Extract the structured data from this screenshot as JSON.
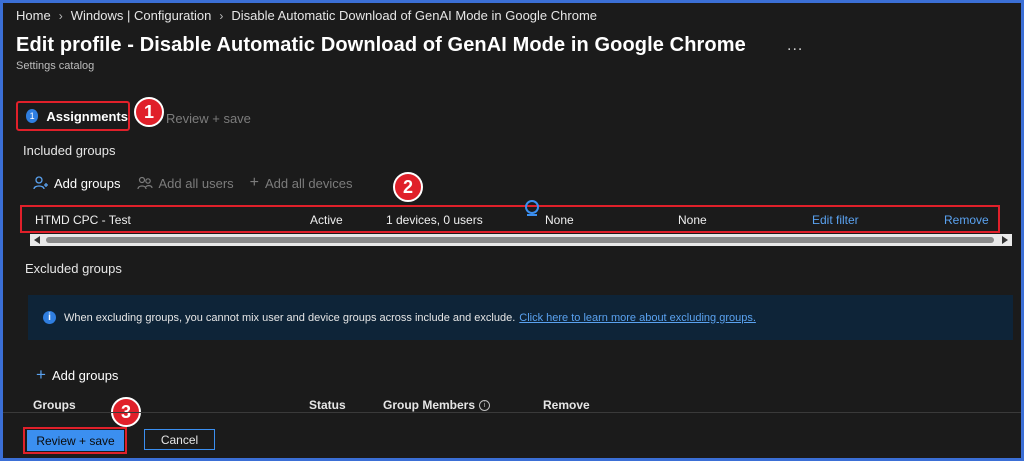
{
  "breadcrumb": {
    "items": [
      "Home",
      "Windows | Configuration",
      "Disable Automatic Download of GenAI Mode in Google Chrome"
    ],
    "separator": ">"
  },
  "page": {
    "title": "Edit profile - Disable Automatic Download of GenAI Mode in Google Chrome",
    "more_label": "...",
    "subtitle": "Settings catalog"
  },
  "steps": {
    "active": {
      "number": "1",
      "label": "Assignments"
    },
    "next": {
      "label": "Review + save"
    }
  },
  "callouts": [
    "1",
    "2",
    "3"
  ],
  "included": {
    "label": "Included groups",
    "toolbar": {
      "add_groups": "Add groups",
      "add_all_users": "Add all users",
      "add_all_devices": "Add all devices"
    },
    "row": {
      "group": "HTMD CPC - Test",
      "status": "Active",
      "members": "1 devices, 0 users",
      "filter": "None",
      "filter_mode": "None",
      "edit_filter": "Edit filter",
      "remove": "Remove"
    }
  },
  "excluded": {
    "label": "Excluded groups",
    "info_text": "When excluding groups, you cannot mix user and device groups across include and exclude.",
    "info_link": "Click here to learn more about excluding groups.",
    "add_groups": "Add groups",
    "columns": {
      "groups": "Groups",
      "status": "Status",
      "members": "Group Members",
      "remove": "Remove"
    }
  },
  "footer": {
    "review_save": "Review + save",
    "cancel": "Cancel"
  },
  "colors": {
    "background": "#1b1b1b",
    "accent": "#3b8ff0",
    "annotation_red": "#e0202a",
    "link": "#5aa2f0",
    "info_bar": "#0e2438",
    "page_border": "#3b6fd6"
  },
  "icons": {
    "add_groups": "person-add-icon",
    "add_all_users": "people-icon",
    "add_all_devices": "plus-icon",
    "info": "info-icon"
  }
}
